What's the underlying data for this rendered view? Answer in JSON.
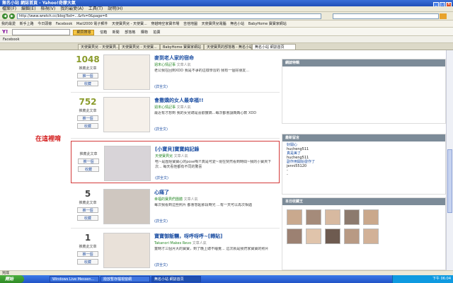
{
  "window": {
    "title": "無名小站 網誌首頁 - Yahoo!奇摩大氣"
  },
  "menu": [
    "檔案(F)",
    "編輯(E)",
    "檢視(V)",
    "我的最愛(A)",
    "工具(T)",
    "說明(H)"
  ],
  "address": {
    "url": "http://www.wretch.cc/blog?bd=...&rfs=0&page=6"
  },
  "bookmarks": [
    "我的最愛",
    "新手上路",
    "今日頭條",
    "Facebook",
    "Mail2000 電子郵件",
    "天使寶貝兒 - 天使寶...",
    "穿越時空家寶市場",
    "吉他地圖",
    "天使寶貝兒電腦",
    "無名小站",
    "BabyHome 寶寶家網站"
  ],
  "yahoo": {
    "logo": "Y!",
    "search_label": "網頁搜尋",
    "items": [
      "信箱",
      "新聞",
      "部落格",
      "購物",
      "拍賣"
    ]
  },
  "facebook_bar": "Facebook",
  "tabs": [
    "天使寶貝兒 - 天使寶貝...",
    "天使寶貝兒 - 天使寶...",
    "BabyHome 寶寶家網站",
    "天使寶貝的部落格 - 無名小站",
    "無名小站 網誌首頁"
  ],
  "posts": [
    {
      "count": "1048",
      "count_label": "推薦此文章",
      "title": "麥到老人家的宿命",
      "category": "週末心情記事",
      "author": "文章人氣",
      "desc": "老公我在回到XDD 我是不爭的這樣學習的 我有一個好朋友...",
      "more": "(詳全文)"
    },
    {
      "count": "752",
      "count_label": "推薦此文章",
      "title": "會撒嬌的女人最幸福!!",
      "category": "週末心情記事",
      "author": "文章人氣",
      "desc": "最近有才想到 我的女兒總是喜歡撒嬌...每次都會讓媽媽心軟 XDD",
      "more": "(詳全文)"
    },
    {
      "count": "",
      "count_label": "推薦此文章",
      "title": "[小寶貝]寶寶純記錄",
      "category": "天使寶貝兒",
      "author": "文章人氣",
      "desc": "唔~是歷經寶寶心的pose嗎?!真是可愛~現在突然看到時間~我的小寶貝下次... 每天看他都有不同的驚喜",
      "more": "(詳全文)"
    },
    {
      "count": "5",
      "count_label": "推薦此文章",
      "title": "心痛了",
      "category": "幸福的寶貝們團體",
      "author": "文章人氣",
      "desc": "每次我看到這些照片 都會想起那段時光 ...有一天可以再次相遇",
      "more": "(詳全文)"
    },
    {
      "count": "1",
      "count_label": "推薦此文章",
      "title": "寶寶御飯糰，呀呼呀呼~[轉貼]",
      "category": "Takanori Makes Revo",
      "author": "文章人氣",
      "desc": "童時才三個月大的寶寶，到了晚上總不睡覺... 這次就是我們家寶寶的照片",
      "more": "(詳全文)"
    }
  ],
  "buttons": {
    "recommend": "推一個",
    "collect": "收藏"
  },
  "annotation": "在這裡唷",
  "sidebar": {
    "panel1_title": "網誌特輯",
    "panel2_title": "最新留言",
    "comments": [
      "好開心",
      "hucheng511",
      "真是美了",
      "hucheng511",
      "副作用開始發作了",
      "jenni55120",
      "-",
      "-"
    ],
    "panel3_title": "本日收藏王",
    "faces": [
      "a",
      "b",
      "c",
      "d",
      "e",
      "f",
      "g",
      "h",
      "i",
      "j"
    ]
  },
  "statusbar": "完成",
  "taskbar": {
    "start": "開始",
    "tasks": [
      "Windows Live Messen...",
      "撥放暫存檔視窗網",
      "無名小站 網誌首頁"
    ],
    "tray": "下午 06:04"
  }
}
